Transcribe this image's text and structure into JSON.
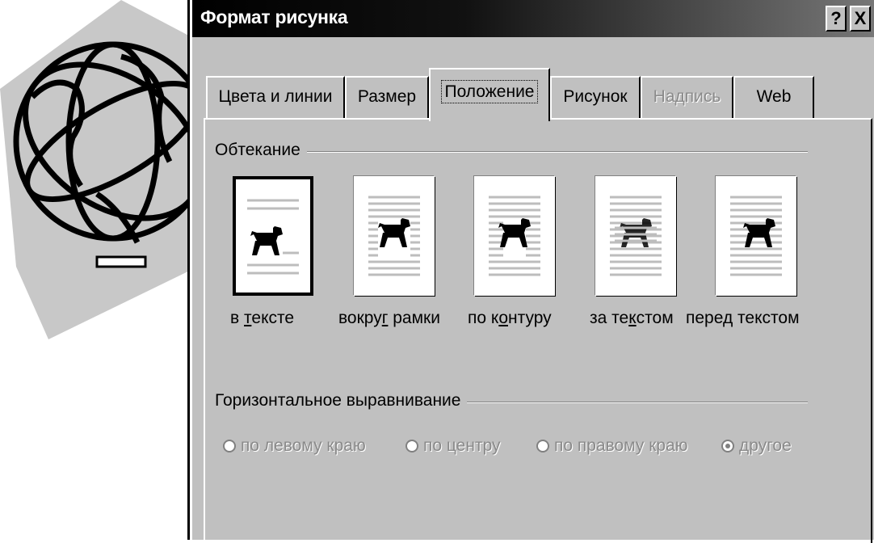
{
  "window": {
    "title": "Формат рисунка",
    "help_label": "?",
    "close_label": "X"
  },
  "tabs": [
    {
      "label": "Цвета и линии",
      "state": "normal"
    },
    {
      "label": "Размер",
      "state": "normal"
    },
    {
      "label": "Положение",
      "state": "active"
    },
    {
      "label": "Рисунок",
      "state": "normal"
    },
    {
      "label": "Надпись",
      "state": "disabled"
    },
    {
      "label": "Web",
      "state": "normal"
    }
  ],
  "wrapping": {
    "group_label": "Обтекание",
    "options": [
      {
        "pre": "в ",
        "mnemonic": "т",
        "post": "ексте",
        "selected": true,
        "icon": "dog-inline-icon"
      },
      {
        "pre": "вокру",
        "mnemonic": "г",
        "post": " рамки",
        "selected": false,
        "icon": "dog-square-icon"
      },
      {
        "pre": "по к",
        "mnemonic": "о",
        "post": "нтуру",
        "selected": false,
        "icon": "dog-tight-icon"
      },
      {
        "pre": "за те",
        "mnemonic": "к",
        "post": "стом",
        "selected": false,
        "icon": "dog-behind-text-icon"
      },
      {
        "pre": "пере",
        "mnemonic": "д",
        "post": " текстом",
        "selected": false,
        "icon": "dog-in-front-icon"
      }
    ]
  },
  "alignment": {
    "group_label": "Горизонтальное выравнивание",
    "options": [
      {
        "label": "по левому краю",
        "checked": false
      },
      {
        "label": "по центру",
        "checked": false
      },
      {
        "label": "по правому краю",
        "checked": false
      },
      {
        "label": "другое",
        "checked": true
      }
    ]
  },
  "colors": {
    "dialog_face": "#c0c0c0",
    "title_bar": "#000000",
    "disabled_text": "#8a8a8a"
  }
}
